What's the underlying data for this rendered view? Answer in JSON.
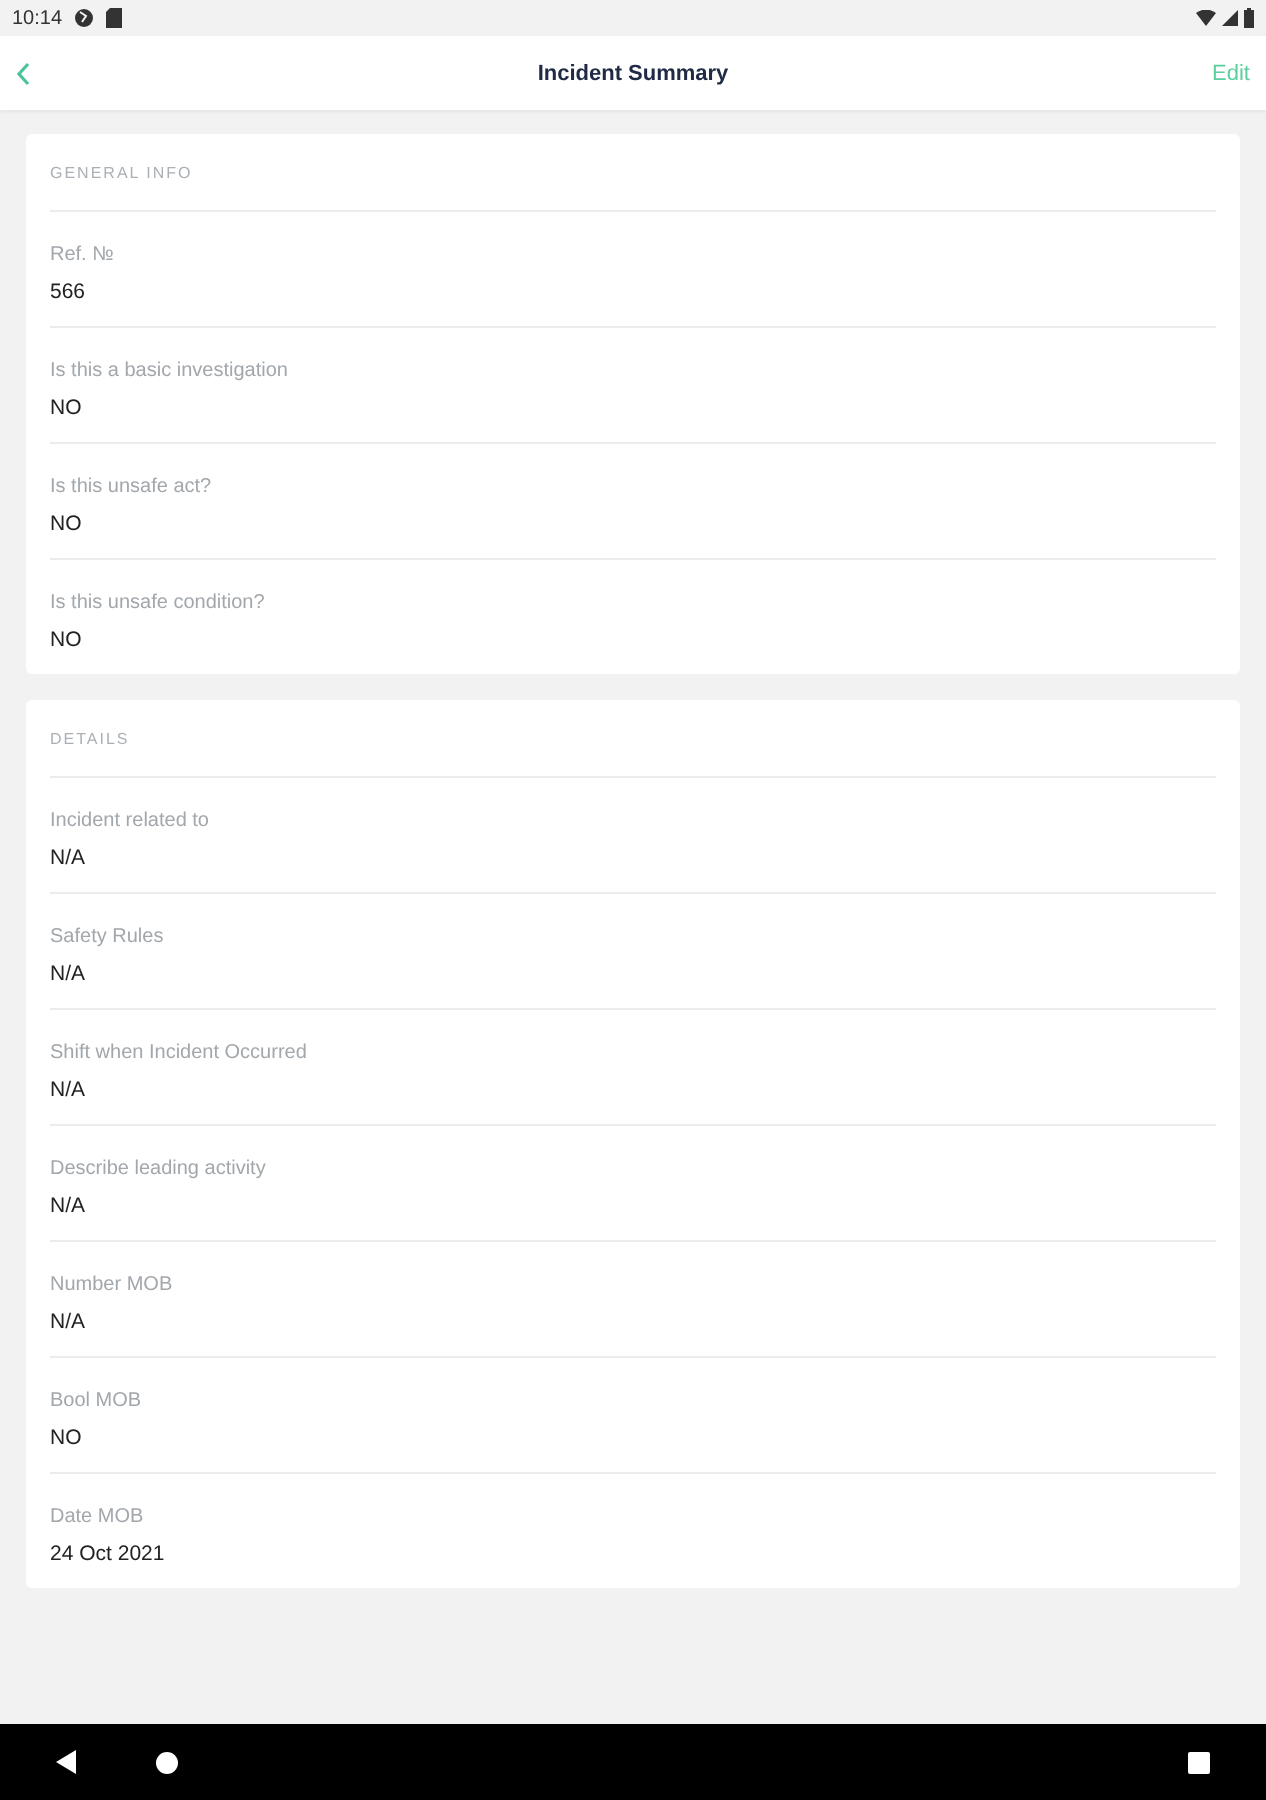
{
  "status_bar": {
    "time": "10:14"
  },
  "header": {
    "title": "Incident Summary",
    "action": "Edit"
  },
  "sections": [
    {
      "title": "GENERAL INFO",
      "fields": [
        {
          "label": "Ref. №",
          "value": "566"
        },
        {
          "label": "Is this a basic investigation",
          "value": "NO"
        },
        {
          "label": "Is this unsafe act?",
          "value": "NO"
        },
        {
          "label": "Is this unsafe condition?",
          "value": "NO"
        }
      ]
    },
    {
      "title": "DETAILS",
      "fields": [
        {
          "label": "Incident related to",
          "value": "N/A"
        },
        {
          "label": "Safety Rules",
          "value": "N/A"
        },
        {
          "label": "Shift when Incident Occurred",
          "value": "N/A"
        },
        {
          "label": "Describe leading activity",
          "value": "N/A"
        },
        {
          "label": "Number MOB",
          "value": "N/A"
        },
        {
          "label": "Bool MOB",
          "value": "NO"
        },
        {
          "label": "Date MOB",
          "value": "24 Oct 2021"
        }
      ]
    }
  ]
}
